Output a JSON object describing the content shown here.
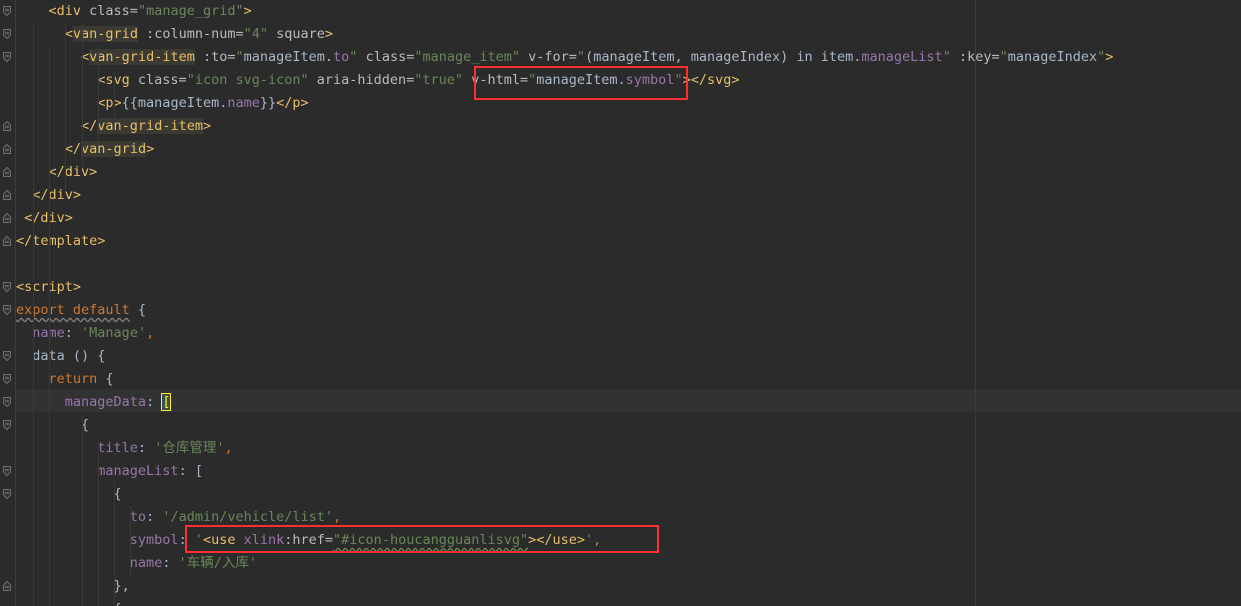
{
  "editor": {
    "code_lines": [
      {
        "segments": [
          {
            "t": "    ",
            "c": "t-text"
          },
          {
            "t": "<div ",
            "c": "t-tag"
          },
          {
            "t": "class=",
            "c": "t-attr"
          },
          {
            "t": "\"manage_grid\"",
            "c": "t-str"
          },
          {
            "t": ">",
            "c": "t-tag"
          }
        ]
      },
      {
        "segments": [
          {
            "t": "      ",
            "c": "t-text"
          },
          {
            "t": "<",
            "c": "t-tag"
          },
          {
            "t": "van-grid",
            "c": "t-van"
          },
          {
            "t": " :column-num=",
            "c": "t-attr"
          },
          {
            "t": "\"4\"",
            "c": "t-str"
          },
          {
            "t": " square",
            "c": "t-attr"
          },
          {
            "t": ">",
            "c": "t-tag"
          }
        ]
      },
      {
        "segments": [
          {
            "t": "        ",
            "c": "t-text"
          },
          {
            "t": "<",
            "c": "t-tag"
          },
          {
            "t": "van-grid-item",
            "c": "t-van"
          },
          {
            "t": " :to=",
            "c": "t-attr"
          },
          {
            "t": "\"",
            "c": "t-str"
          },
          {
            "t": "manageItem.",
            "c": "t-bind"
          },
          {
            "t": "to",
            "c": "t-prop"
          },
          {
            "t": "\"",
            "c": "t-str"
          },
          {
            "t": " class=",
            "c": "t-attr"
          },
          {
            "t": "\"manage_item\"",
            "c": "t-str"
          },
          {
            "t": " v-for=",
            "c": "t-attr"
          },
          {
            "t": "\"",
            "c": "t-str"
          },
          {
            "t": "(manageItem, manageIndex) in item.",
            "c": "t-bind"
          },
          {
            "t": "manageList",
            "c": "t-prop"
          },
          {
            "t": "\"",
            "c": "t-str"
          },
          {
            "t": " :key=",
            "c": "t-attr"
          },
          {
            "t": "\"",
            "c": "t-str"
          },
          {
            "t": "manageIndex",
            "c": "t-bind"
          },
          {
            "t": "\"",
            "c": "t-str"
          },
          {
            "t": ">",
            "c": "t-tag"
          }
        ]
      },
      {
        "segments": [
          {
            "t": "          ",
            "c": "t-text"
          },
          {
            "t": "<svg ",
            "c": "t-tag"
          },
          {
            "t": "class=",
            "c": "t-attr"
          },
          {
            "t": "\"icon svg-icon\"",
            "c": "t-str"
          },
          {
            "t": " aria-hidden=",
            "c": "t-attr"
          },
          {
            "t": "\"true\"",
            "c": "t-str"
          },
          {
            "t": " v-html=",
            "c": "t-attr"
          },
          {
            "t": "\"",
            "c": "t-str"
          },
          {
            "t": "manageItem.",
            "c": "t-bind"
          },
          {
            "t": "symbol",
            "c": "t-prop"
          },
          {
            "t": "\"",
            "c": "t-str"
          },
          {
            "t": "></svg>",
            "c": "t-tag"
          }
        ]
      },
      {
        "segments": [
          {
            "t": "          ",
            "c": "t-text"
          },
          {
            "t": "<p>",
            "c": "t-tag"
          },
          {
            "t": "{{manageItem.",
            "c": "t-text"
          },
          {
            "t": "name",
            "c": "t-prop"
          },
          {
            "t": "}}",
            "c": "t-text"
          },
          {
            "t": "</p>",
            "c": "t-tag"
          }
        ]
      },
      {
        "segments": [
          {
            "t": "        ",
            "c": "t-text"
          },
          {
            "t": "</",
            "c": "t-tag"
          },
          {
            "t": "van-grid-item",
            "c": "t-van"
          },
          {
            "t": ">",
            "c": "t-tag"
          }
        ]
      },
      {
        "segments": [
          {
            "t": "      ",
            "c": "t-text"
          },
          {
            "t": "</",
            "c": "t-tag"
          },
          {
            "t": "van-grid",
            "c": "t-van"
          },
          {
            "t": ">",
            "c": "t-tag"
          }
        ]
      },
      {
        "segments": [
          {
            "t": "    ",
            "c": "t-text"
          },
          {
            "t": "</div>",
            "c": "t-tag"
          }
        ]
      },
      {
        "segments": [
          {
            "t": "  ",
            "c": "t-text"
          },
          {
            "t": "</div>",
            "c": "t-tag"
          }
        ]
      },
      {
        "segments": [
          {
            "t": " ",
            "c": "t-text"
          },
          {
            "t": "</div>",
            "c": "t-tag"
          }
        ]
      },
      {
        "segments": [
          {
            "t": "</template>",
            "c": "t-tag"
          }
        ]
      },
      {
        "segments": []
      },
      {
        "segments": [
          {
            "t": "<script>",
            "c": "t-tag"
          }
        ]
      },
      {
        "segments": [
          {
            "t": "export default",
            "c": "t-kw t-squig-grey"
          },
          {
            "t": " {",
            "c": "t-text"
          }
        ]
      },
      {
        "segments": [
          {
            "t": "  ",
            "c": "t-text"
          },
          {
            "t": "name",
            "c": "t-prop"
          },
          {
            "t": ": ",
            "c": "t-text"
          },
          {
            "t": "'Manage'",
            "c": "t-str"
          },
          {
            "t": ",",
            "c": "t-kw"
          }
        ]
      },
      {
        "segments": [
          {
            "t": "  data () {",
            "c": "t-text"
          }
        ]
      },
      {
        "segments": [
          {
            "t": "    ",
            "c": "t-text"
          },
          {
            "t": "return",
            "c": "t-kw"
          },
          {
            "t": " {",
            "c": "t-text"
          }
        ]
      },
      {
        "segments": [
          {
            "t": "      ",
            "c": "t-text"
          },
          {
            "t": "manageData",
            "c": "t-prop"
          },
          {
            "t": ": ",
            "c": "t-text"
          },
          {
            "t": "[",
            "c": "t-bracket-match"
          }
        ]
      },
      {
        "segments": [
          {
            "t": "        {",
            "c": "t-text"
          }
        ]
      },
      {
        "segments": [
          {
            "t": "          ",
            "c": "t-text"
          },
          {
            "t": "title",
            "c": "t-prop"
          },
          {
            "t": ": ",
            "c": "t-text"
          },
          {
            "t": "'仓库管理'",
            "c": "t-str"
          },
          {
            "t": ",",
            "c": "t-kw"
          }
        ]
      },
      {
        "segments": [
          {
            "t": "          ",
            "c": "t-text"
          },
          {
            "t": "manageList",
            "c": "t-prop"
          },
          {
            "t": ": [",
            "c": "t-text"
          }
        ]
      },
      {
        "segments": [
          {
            "t": "            {",
            "c": "t-text"
          }
        ]
      },
      {
        "segments": [
          {
            "t": "              ",
            "c": "t-text"
          },
          {
            "t": "to",
            "c": "t-prop"
          },
          {
            "t": ": ",
            "c": "t-text"
          },
          {
            "t": "'/admin/vehicle/list'",
            "c": "t-str"
          },
          {
            "t": ",",
            "c": "t-kw"
          }
        ]
      },
      {
        "segments": [
          {
            "t": "              ",
            "c": "t-text"
          },
          {
            "t": "symbol",
            "c": "t-prop"
          },
          {
            "t": ": ",
            "c": "t-text"
          },
          {
            "t": "'",
            "c": "t-str"
          },
          {
            "t": "<use ",
            "c": "t-tag"
          },
          {
            "t": "xlink",
            "c": "t-prop"
          },
          {
            "t": ":href=",
            "c": "t-attr"
          },
          {
            "t": "\"#icon-houcangguanlisvg\"",
            "c": "t-str t-squig"
          },
          {
            "t": "></use>",
            "c": "t-tag"
          },
          {
            "t": "'",
            "c": "t-str"
          },
          {
            "t": ",",
            "c": "t-kw"
          }
        ]
      },
      {
        "segments": [
          {
            "t": "              ",
            "c": "t-text"
          },
          {
            "t": "name",
            "c": "t-prop"
          },
          {
            "t": ": ",
            "c": "t-text"
          },
          {
            "t": "'车辆/入库'",
            "c": "t-str"
          }
        ]
      },
      {
        "segments": [
          {
            "t": "            },",
            "c": "t-text"
          }
        ]
      },
      {
        "segments": [
          {
            "t": "            {",
            "c": "t-text"
          }
        ]
      }
    ]
  }
}
